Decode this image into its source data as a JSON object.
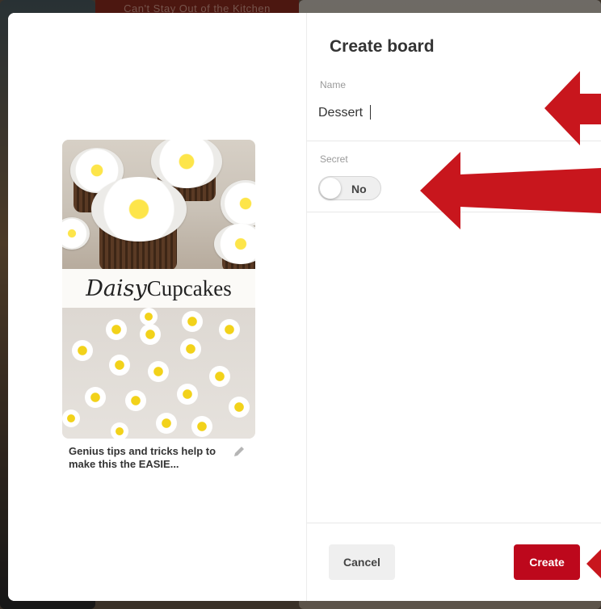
{
  "background": {
    "banner_text": "Can't Stay Out of the Kitchen"
  },
  "pin": {
    "image_text_script": "Daisy",
    "image_text_serif": "Cupcakes",
    "title": "Genius tips and tricks help to make this the EASIE..."
  },
  "form": {
    "header": "Create board",
    "name_label": "Name",
    "name_value": "Dessert",
    "secret_label": "Secret",
    "secret_toggle_text": "No"
  },
  "footer": {
    "cancel_label": "Cancel",
    "create_label": "Create"
  },
  "colors": {
    "primary": "#bd081c",
    "annotation_arrow": "#c8161d"
  }
}
